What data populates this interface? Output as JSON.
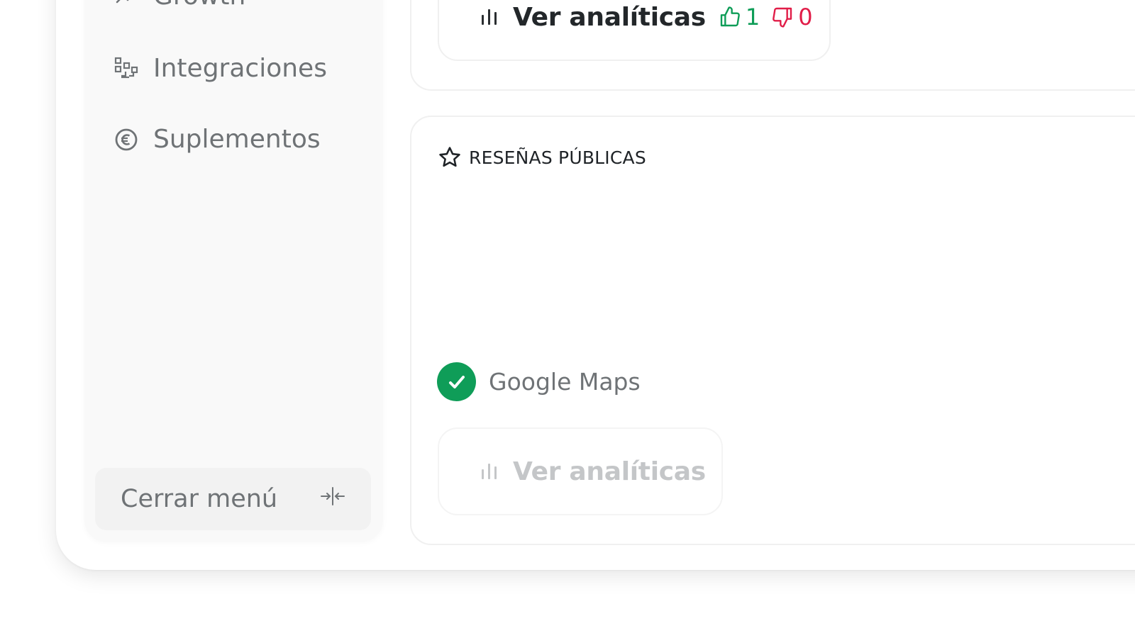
{
  "sidebar": {
    "items": [
      {
        "label": "Growth",
        "icon": "trending-up-icon"
      },
      {
        "label": "Integraciones",
        "icon": "integrations-icon"
      },
      {
        "label": "Suplementos",
        "icon": "euro-circle-icon"
      }
    ],
    "close_menu": {
      "label": "Cerrar menú",
      "icon": "collapse-icon"
    }
  },
  "top_panel": {
    "analytics_button": {
      "label": "Ver analíticas",
      "icon": "bar-chart-icon",
      "likes": "1",
      "dislikes": "0"
    }
  },
  "reviews_panel": {
    "title": "RESEÑAS PÚBLICAS",
    "title_icon": "star-icon",
    "source": {
      "label": "Google Maps",
      "status": "connected",
      "icon": "check-circle-icon"
    },
    "analytics_button": {
      "label": "Ver analíticas",
      "icon": "bar-chart-icon",
      "disabled": true
    }
  },
  "colors": {
    "accent_green": "#0f9d58",
    "negative_red": "#e11d48",
    "sidebar_bg": "#f9f9f9",
    "muted_text": "#6f7376"
  }
}
